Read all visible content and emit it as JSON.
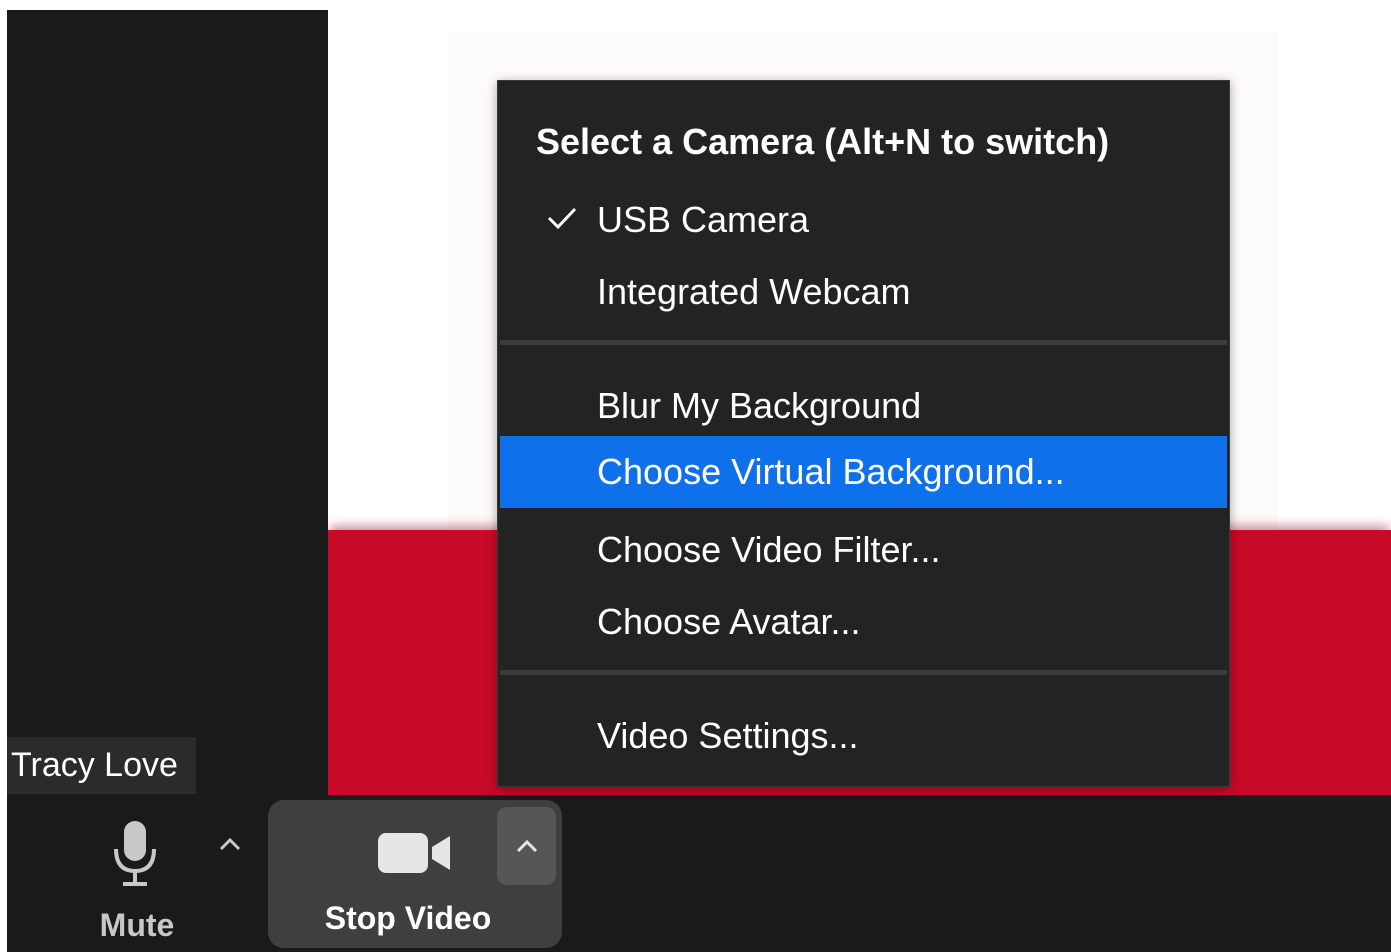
{
  "participant": {
    "name": "Tracy Love"
  },
  "toolbar": {
    "mute_label": "Mute",
    "stop_video_label": "Stop Video",
    "icons": {
      "microphone": "microphone-icon",
      "camera": "video-camera-icon",
      "caret": "chevron-up-icon"
    }
  },
  "camera_menu": {
    "header": "Select a Camera (Alt+N to switch)",
    "cameras": [
      {
        "label": "USB Camera",
        "checked": true
      },
      {
        "label": "Integrated Webcam",
        "checked": false
      }
    ],
    "background_items": [
      {
        "label": "Blur My Background",
        "highlighted": false
      },
      {
        "label": "Choose Virtual Background...",
        "highlighted": true
      },
      {
        "label": "Choose Video Filter...",
        "highlighted": false
      },
      {
        "label": "Choose Avatar...",
        "highlighted": false
      }
    ],
    "settings_item": {
      "label": "Video Settings..."
    }
  },
  "colors": {
    "menu_bg": "#232323",
    "highlight": "#0e71eb",
    "video_red": "#c60a28",
    "toolbar_bg": "#1a1a1a"
  }
}
